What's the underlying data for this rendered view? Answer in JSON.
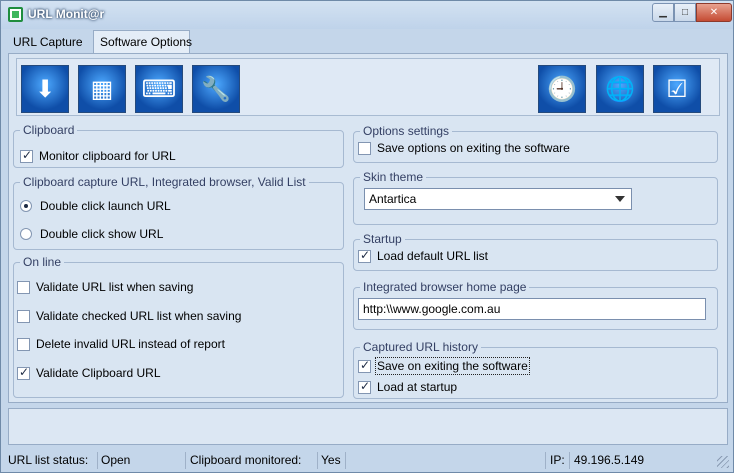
{
  "window": {
    "title": "URL Monit@r",
    "buttons": {
      "minimize": "▁",
      "maximize": "□",
      "close": "✕"
    }
  },
  "tabs": [
    {
      "label": "URL Capture",
      "active": false
    },
    {
      "label": "Software Options",
      "active": true
    }
  ],
  "toolbar": {
    "icons": [
      {
        "name": "download-drive-icon",
        "glyph": "⬇"
      },
      {
        "name": "window-panel-icon",
        "glyph": "▦"
      },
      {
        "name": "keyboard-icon",
        "glyph": "⌨"
      },
      {
        "name": "tools-globe-icon",
        "glyph": "🔧"
      },
      {
        "name": "clock-icon",
        "glyph": "🕘"
      },
      {
        "name": "globe-download-icon",
        "glyph": "🌐"
      },
      {
        "name": "checklist-shortcut-icon",
        "glyph": "☑"
      }
    ]
  },
  "clipboard": {
    "legend": "Clipboard",
    "monitor": {
      "label": "Monitor clipboard for URL",
      "checked": true
    }
  },
  "capture": {
    "legend": "Clipboard capture URL, Integrated browser, Valid List",
    "options": [
      {
        "label": "Double click launch URL",
        "checked": true
      },
      {
        "label": "Double click show URL",
        "checked": false
      }
    ]
  },
  "online": {
    "legend": "On line",
    "options": [
      {
        "label": "Validate URL list when saving",
        "checked": false
      },
      {
        "label": "Validate checked URL list when saving",
        "checked": false
      },
      {
        "label": "Delete invalid URL instead of report",
        "checked": false
      },
      {
        "label": "Validate Clipboard URL",
        "checked": true
      }
    ]
  },
  "options_settings": {
    "legend": "Options settings",
    "save": {
      "label": "Save options on exiting the software",
      "checked": false
    }
  },
  "skin": {
    "legend": "Skin theme",
    "selected": "Antartica"
  },
  "startup": {
    "legend": "Startup",
    "load_default": {
      "label": "Load default URL list",
      "checked": true
    }
  },
  "browser": {
    "legend": "Integrated browser home page",
    "url": "http:\\\\www.google.com.au"
  },
  "history": {
    "legend": "Captured URL history",
    "save": {
      "label": "Save on exiting the software",
      "checked": true
    },
    "load": {
      "label": "Load at startup",
      "checked": true
    }
  },
  "statusbar": {
    "url_list_label": "URL list status:",
    "url_list_value": "Open",
    "clipboard_label": "Clipboard monitored:",
    "clipboard_value": "Yes",
    "ip_label": "IP:",
    "ip_value": "49.196.5.149"
  }
}
